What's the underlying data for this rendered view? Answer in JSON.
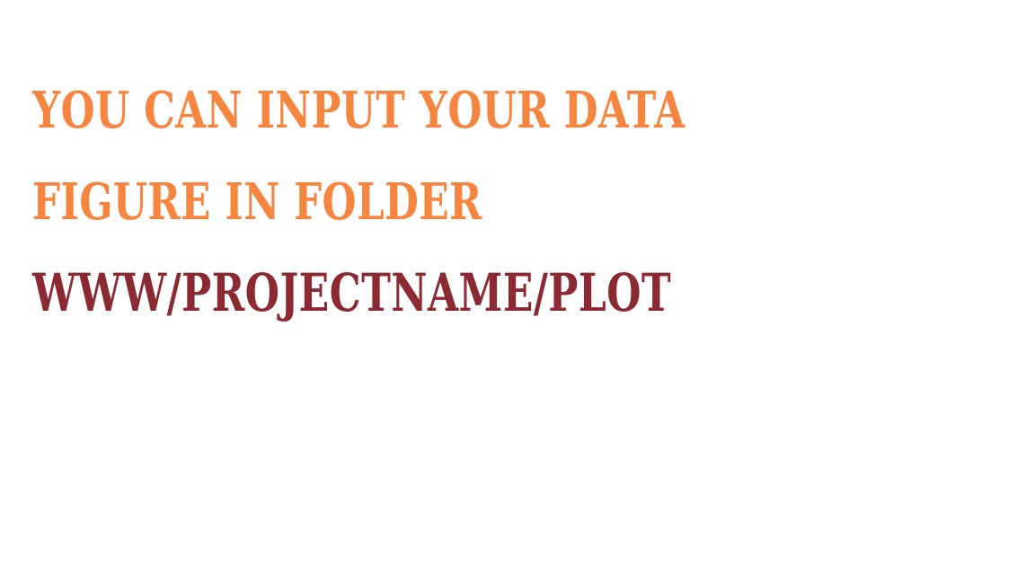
{
  "lines": [
    {
      "text": "YOU CAN INPUT YOUR DATA",
      "color": "#f5853f"
    },
    {
      "text": "FIGURE IN FOLDER",
      "color": "#f5853f"
    },
    {
      "text": "WWW/PROJECTNAME/PLOT",
      "color": "#8b2a32"
    }
  ],
  "colors": {
    "background": "#ffffff",
    "accent_orange": "#f5853f",
    "accent_maroon": "#8b2a32"
  }
}
